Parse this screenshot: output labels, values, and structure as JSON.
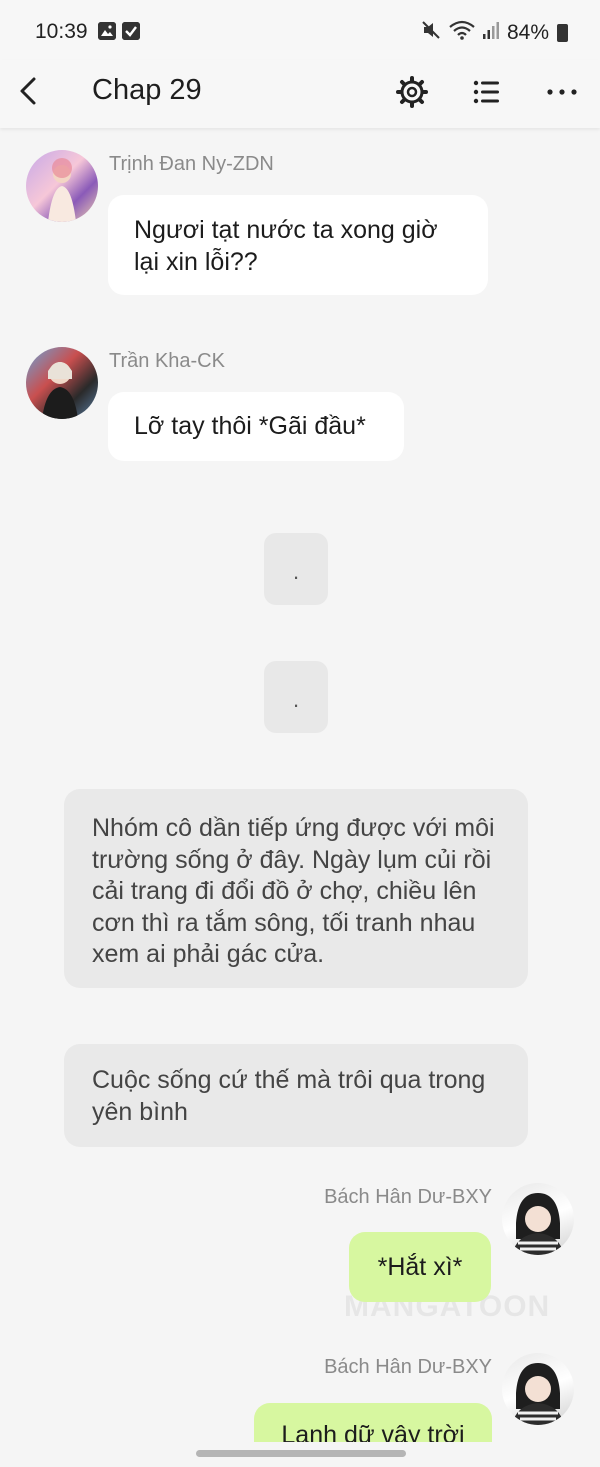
{
  "status_bar": {
    "time": "10:39",
    "battery": "84%"
  },
  "header": {
    "title": "Chap 29"
  },
  "messages": [
    {
      "sender": "Trịnh Đan Ny-ZDN",
      "text": "Ngươi tạt nước ta xong giờ lại xin lỗi??"
    },
    {
      "sender": "Trần Kha-CK",
      "text": "Lỡ tay thôi *Gãi đầu*"
    }
  ],
  "dots": [
    ".",
    "."
  ],
  "narrations": [
    "Nhóm cô dần tiếp ứng được với môi trường sống ở đây. Ngày lụm củi rồi cải trang đi đổi đồ ở chợ, chiều lên cơn thì ra tắm sông, tối tranh nhau xem ai phải gác cửa.",
    "Cuộc sống cứ thế mà trôi qua trong yên bình"
  ],
  "right_messages": [
    {
      "sender": "Bách Hân Dư-BXY",
      "text": "*Hắt xì*"
    },
    {
      "sender": "Bách Hân Dư-BXY",
      "text": "Lạnh dữ vậy trời"
    }
  ],
  "watermark": "MANGATOON",
  "colors": {
    "right_bubble": "#d7f7a0",
    "left_bubble": "#ffffff",
    "background": "#f5f5f5",
    "narration": "#e9e9e9"
  },
  "icons": [
    "back-icon",
    "gear-icon",
    "list-icon",
    "more-icon"
  ]
}
